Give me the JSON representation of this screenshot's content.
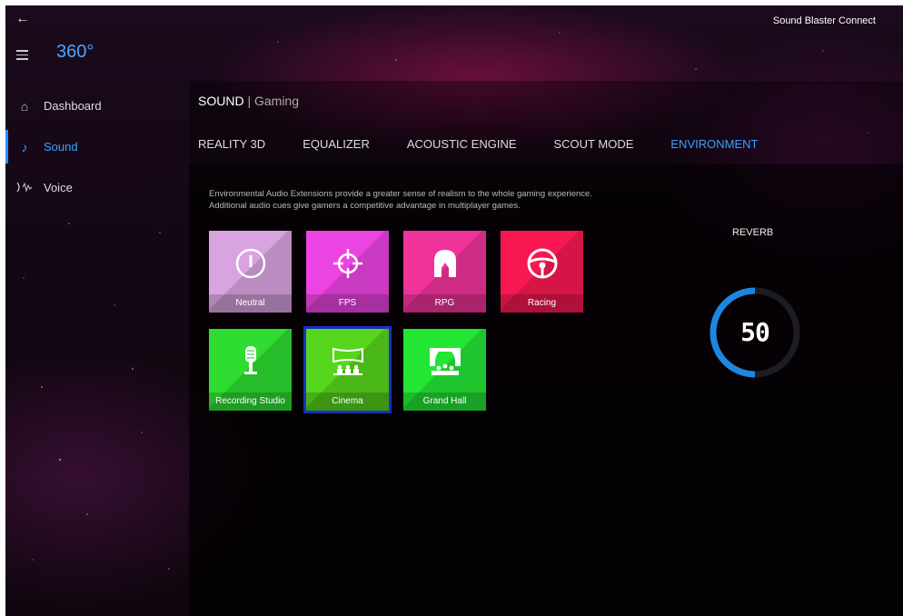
{
  "window": {
    "title": "Sound Blaster Connect"
  },
  "header": {
    "brand": "360°"
  },
  "sidebar": {
    "items": [
      {
        "label": "Dashboard",
        "icon": "home-icon"
      },
      {
        "label": "Sound",
        "icon": "music-note-icon",
        "active": true
      },
      {
        "label": "Voice",
        "icon": "voice-wave-icon"
      }
    ]
  },
  "breadcrumb": {
    "section": "SOUND",
    "separator": "|",
    "sub": "Gaming"
  },
  "tabs": [
    {
      "label": "REALITY 3D"
    },
    {
      "label": "EQUALIZER"
    },
    {
      "label": "ACOUSTIC ENGINE"
    },
    {
      "label": "SCOUT MODE"
    },
    {
      "label": "ENVIRONMENT",
      "active": true
    }
  ],
  "environment": {
    "description_line1": "Environmental Audio Extensions provide a greater sense of realism to the whole gaming experience.",
    "description_line2": "Additional audio cues give gamers a competitive advantage in multiplayer games.",
    "presets": [
      {
        "label": "Neutral",
        "icon": "power-icon",
        "color": "#d9a3e0"
      },
      {
        "label": "FPS",
        "icon": "crosshair-icon",
        "color": "#ec44e2"
      },
      {
        "label": "RPG",
        "icon": "helmet-icon",
        "color": "#f0339b"
      },
      {
        "label": "Racing",
        "icon": "steering-wheel-icon",
        "color": "#f71852"
      },
      {
        "label": "Recording Studio",
        "icon": "microphone-icon",
        "color": "#2fdc32"
      },
      {
        "label": "Cinema",
        "icon": "cinema-screen-icon",
        "color": "#56d61d",
        "selected": true
      },
      {
        "label": "Grand Hall",
        "icon": "theater-icon",
        "color": "#23e534"
      }
    ],
    "reverb": {
      "label": "REVERB",
      "value": "50",
      "level": 0.5,
      "accent": "#1f86e0"
    }
  }
}
